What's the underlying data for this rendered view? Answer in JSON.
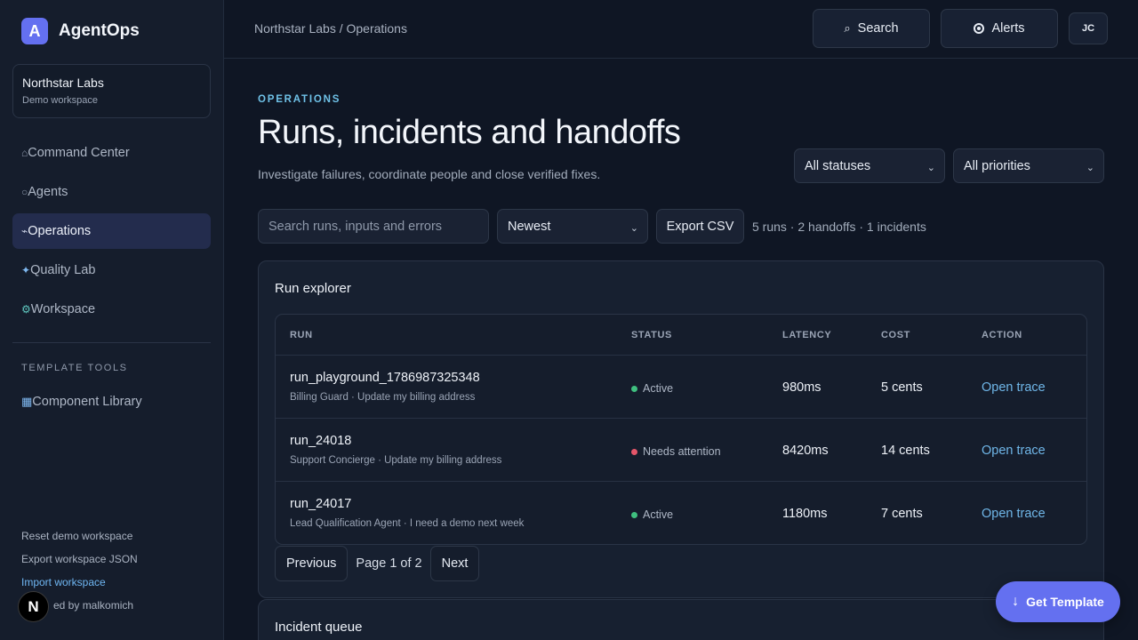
{
  "brand": {
    "logo_letter": "A",
    "name": "AgentOps"
  },
  "workspace": {
    "name": "Northstar Labs",
    "subtitle": "Demo workspace"
  },
  "nav": {
    "items": [
      {
        "icon": "⌂",
        "icon_name": "home-icon",
        "label": "Command Center"
      },
      {
        "icon": "○",
        "icon_name": "agents-icon",
        "label": "Agents"
      },
      {
        "icon": "⌁",
        "icon_name": "operations-icon",
        "label": "Operations"
      },
      {
        "icon": "✦",
        "icon_name": "sparkle-icon",
        "label": "Quality Lab"
      },
      {
        "icon": "⚙",
        "icon_name": "gear-icon",
        "label": "Workspace"
      }
    ],
    "active_index": 2
  },
  "tools": {
    "title": "TEMPLATE TOOLS",
    "item": {
      "icon": "▦",
      "icon_name": "grid-icon",
      "label": "Component Library"
    }
  },
  "footer": {
    "reset": "Reset demo workspace",
    "export": "Export workspace JSON",
    "import": "Import workspace",
    "credit": "ed by malkomich",
    "badge": "N"
  },
  "topbar": {
    "breadcrumb": "Northstar Labs / Operations",
    "search_icon": "⌕",
    "search_label": "Search",
    "alerts_label": "Alerts",
    "avatar": "JC"
  },
  "page": {
    "eyebrow": "OPERATIONS",
    "title": "Runs, incidents and handoffs",
    "subtitle": "Investigate failures, coordinate people and close verified fixes."
  },
  "filters": {
    "status": "All statuses",
    "priority": "All priorities",
    "chevron": "⌄"
  },
  "toolbar": {
    "search_placeholder": "Search runs, inputs and errors",
    "sort": "Newest",
    "export_label": "Export CSV",
    "summary": "5 runs · 2 handoffs · 1 incidents"
  },
  "run_explorer": {
    "title": "Run explorer",
    "columns": {
      "run": "RUN",
      "status": "STATUS",
      "latency": "LATENCY",
      "cost": "COST",
      "action": "ACTION"
    },
    "rows": [
      {
        "run": "run_playground_1786987325348",
        "sub": "Billing Guard · Update my billing address",
        "status": "Active",
        "status_color": "#3fbf7f",
        "latency": "980ms",
        "cost": "5 cents",
        "action": "Open trace"
      },
      {
        "run": "run_24018",
        "sub": "Support Concierge · Update my billing address",
        "status": "Needs attention",
        "status_color": "#e5566a",
        "latency": "8420ms",
        "cost": "14 cents",
        "action": "Open trace"
      },
      {
        "run": "run_24017",
        "sub": "Lead Qualification Agent · I need a demo next week",
        "status": "Active",
        "status_color": "#3fbf7f",
        "latency": "1180ms",
        "cost": "7 cents",
        "action": "Open trace"
      }
    ],
    "pager": {
      "previous": "Previous",
      "label": "Page 1 of 2",
      "next": "Next"
    }
  },
  "incident_queue": {
    "title": "Incident queue"
  },
  "cta": {
    "icon": "↓",
    "label": "Get Template"
  }
}
